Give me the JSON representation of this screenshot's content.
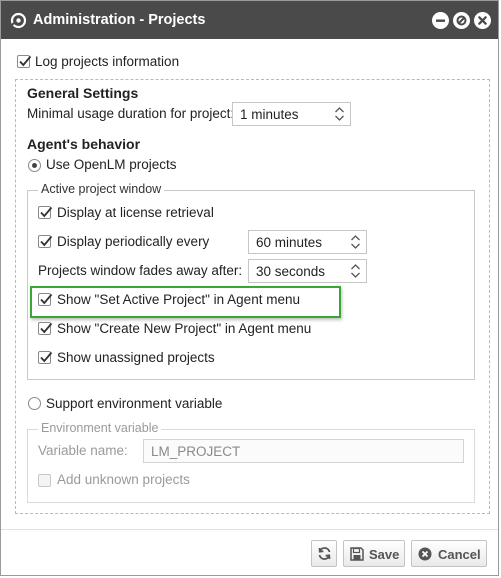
{
  "window": {
    "title": "Administration - Projects",
    "colors": {
      "titlebar": "#4a4a4a",
      "highlight_border": "#3aa63a"
    },
    "title_buttons": [
      "minimize-icon",
      "restore-icon",
      "close-icon"
    ]
  },
  "log_projects": {
    "label": "Log projects information",
    "checked": true
  },
  "general": {
    "heading": "General Settings",
    "min_duration_label": "Minimal usage duration for project:",
    "min_duration_value": "1 minutes"
  },
  "agent": {
    "heading": "Agent's behavior",
    "use_openlm_label": "Use OpenLM projects",
    "active_window_legend": "Active project window",
    "display_retrieval_label": "Display at license retrieval",
    "display_periodic_label": "Display periodically every",
    "display_periodic_value": "60 minutes",
    "fades_label": "Projects window fades away after:",
    "fades_value": "30 seconds",
    "show_set_active_label": "Show \"Set Active Project\" in Agent menu",
    "show_create_new_label": "Show \"Create New Project\" in Agent menu",
    "show_unassigned_label": "Show unassigned projects"
  },
  "env": {
    "support_label": "Support environment variable",
    "legend": "Environment variable",
    "variable_name_label": "Variable name:",
    "variable_name_value": "LM_PROJECT",
    "add_unknown_label": "Add unknown projects"
  },
  "footer": {
    "refresh_icon": "refresh-icon",
    "save_label": "Save",
    "cancel_label": "Cancel"
  }
}
